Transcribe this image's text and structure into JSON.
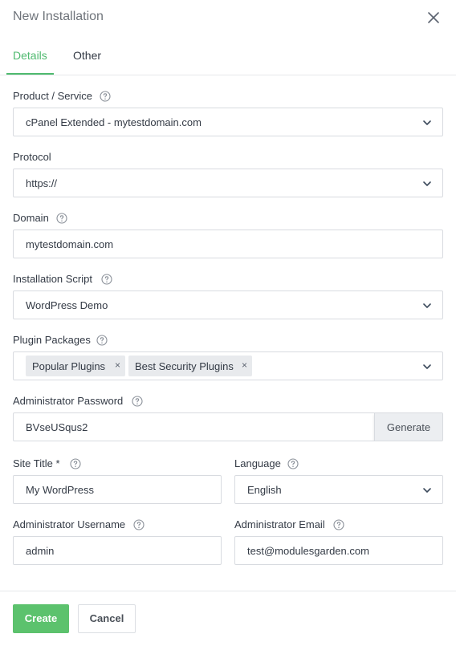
{
  "modal": {
    "title": "New Installation"
  },
  "tabs": [
    {
      "label": "Details",
      "active": true
    },
    {
      "label": "Other",
      "active": false
    }
  ],
  "fields": {
    "product": {
      "label": "Product / Service",
      "value": "cPanel Extended - mytestdomain.com"
    },
    "protocol": {
      "label": "Protocol",
      "value": "https://"
    },
    "domain": {
      "label": "Domain",
      "value": "mytestdomain.com"
    },
    "script": {
      "label": "Installation Script",
      "value": "WordPress Demo"
    },
    "plugins": {
      "label": "Plugin Packages",
      "tags": [
        "Popular Plugins",
        "Best Security Plugins"
      ],
      "remove_glyph": "×"
    },
    "password": {
      "label": "Administrator Password",
      "value": "BVseUSqus2",
      "generate_label": "Generate"
    },
    "site_title": {
      "label": "Site Title *",
      "value": "My WordPress"
    },
    "language": {
      "label": "Language",
      "value": "English"
    },
    "admin_username": {
      "label": "Administrator Username",
      "value": "admin"
    },
    "admin_email": {
      "label": "Administrator Email",
      "value": "test@modulesgarden.com"
    }
  },
  "footer": {
    "create_label": "Create",
    "cancel_label": "Cancel"
  },
  "colors": {
    "accent": "#4fba6f",
    "create_button": "#5cc26d",
    "border": "#d8dbe0"
  },
  "icons": {
    "close": "close-icon",
    "help": "help-circle-icon",
    "select": "chevron-down-icon"
  }
}
